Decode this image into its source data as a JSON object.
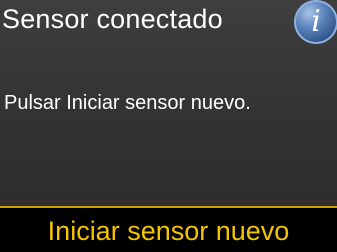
{
  "header": {
    "title": "Sensor conectado",
    "info_icon_glyph": "i",
    "info_icon_name": "info-icon"
  },
  "main": {
    "message": "Pulsar Iniciar sensor nuevo."
  },
  "footer": {
    "action_label": "Iniciar sensor nuevo"
  },
  "colors": {
    "background": "#333333",
    "text": "#ffffff",
    "action_text": "#f5c400",
    "action_border": "#c9a100",
    "info_icon": "#4a6fa8"
  }
}
